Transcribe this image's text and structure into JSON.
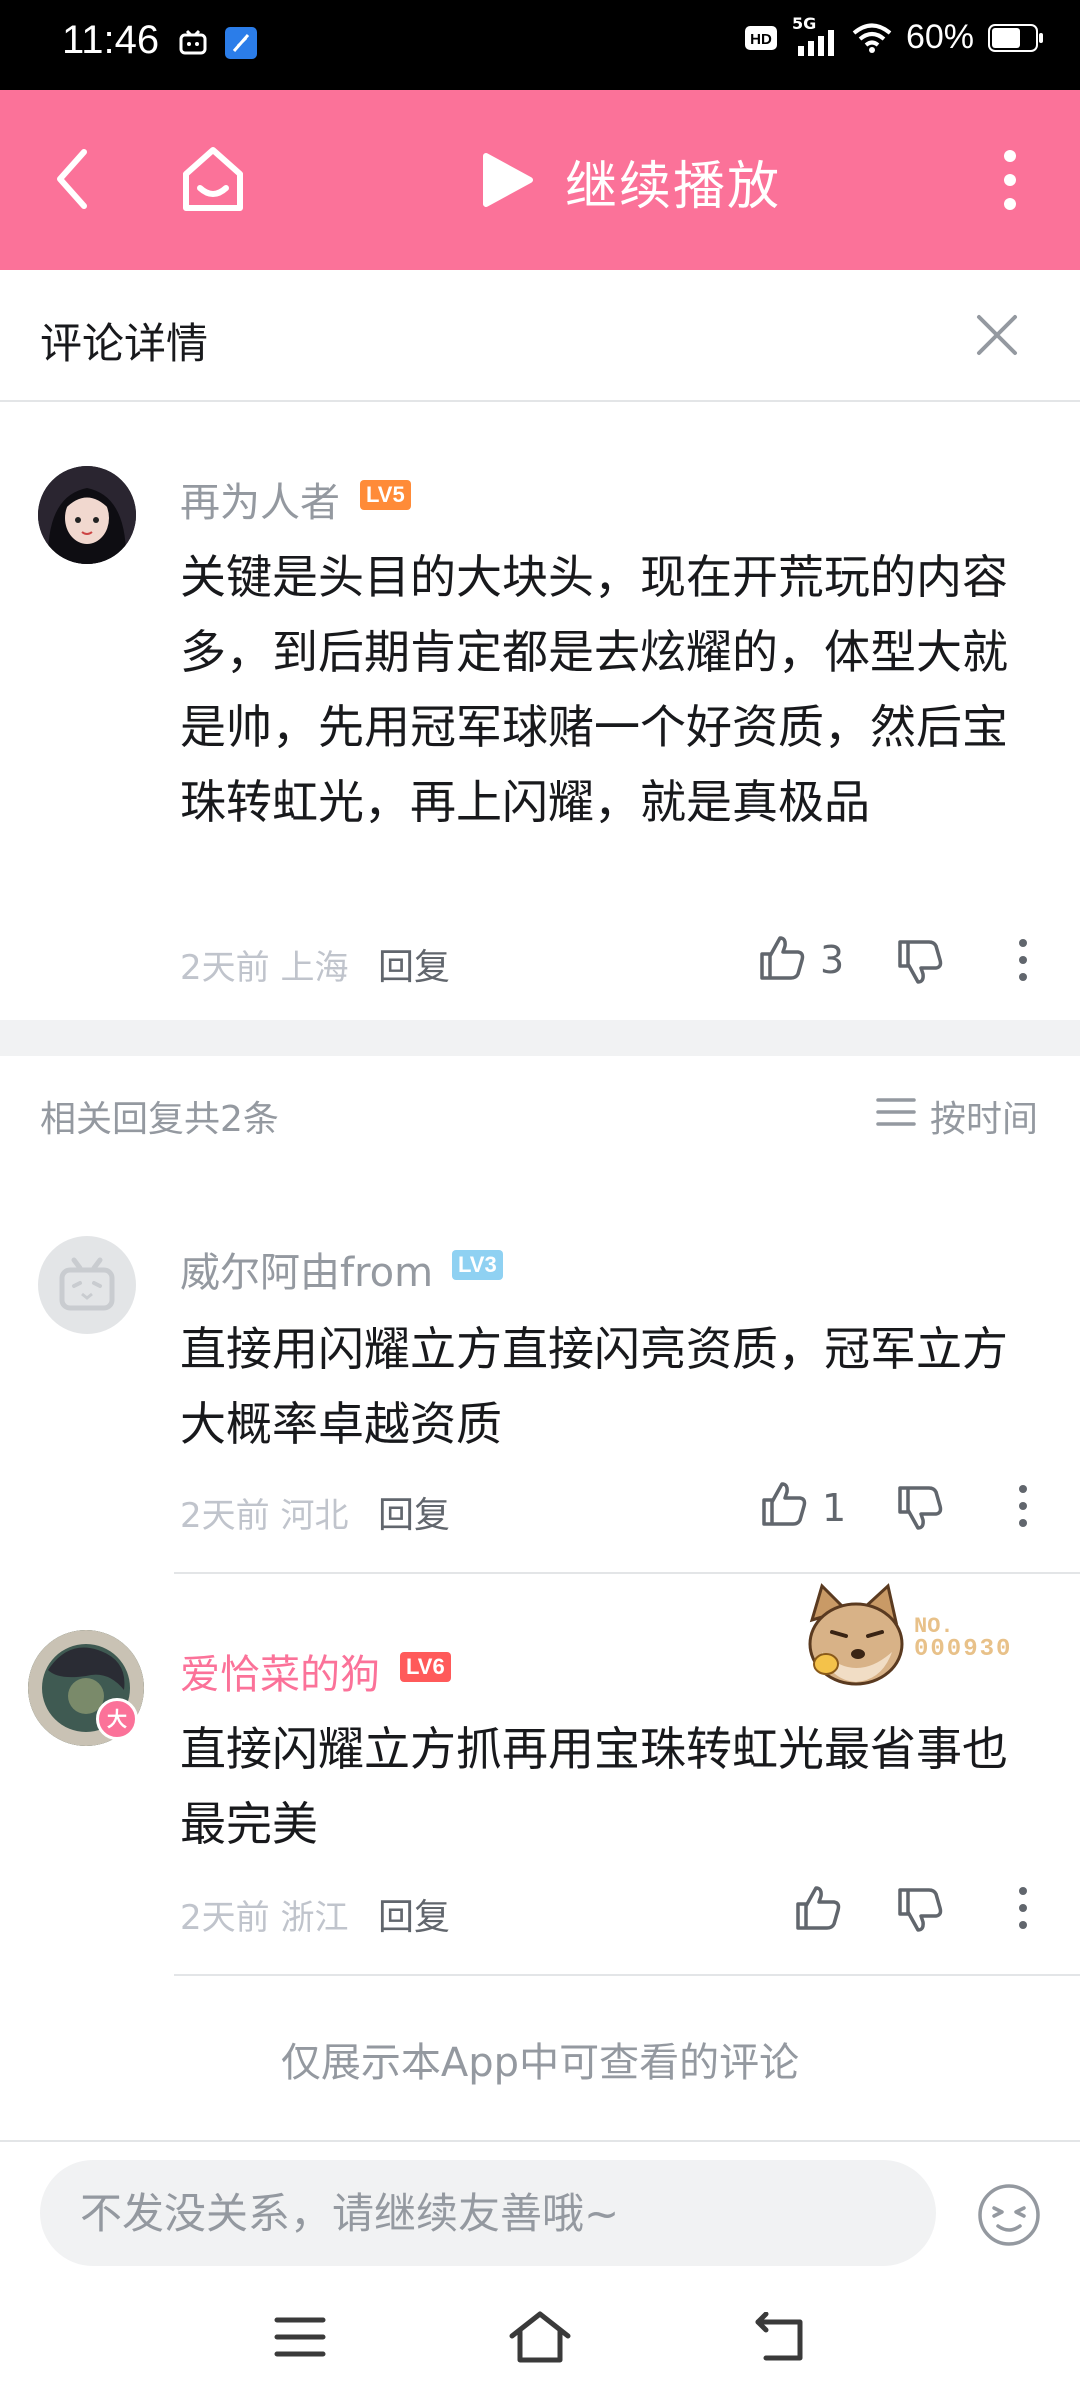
{
  "status": {
    "time": "11:46",
    "network": "5G",
    "battery": "60%"
  },
  "header": {
    "title": "继续播放"
  },
  "detail": {
    "title": "评论详情"
  },
  "main_comment": {
    "user": "再为人者",
    "level": "LV5",
    "text": "关键是头目的大块头，现在开荒玩的内容多，到后期肯定都是去炫耀的，体型大就是帅，先用冠军球赌一个好资质，然后宝珠转虹光，再上闪耀，就是真极品",
    "time": "2天前",
    "location": "上海",
    "reply_label": "回复",
    "likes": "3"
  },
  "replies_header": {
    "count_text": "相关回复共2条",
    "sort_label": "按时间"
  },
  "replies": [
    {
      "user": "威尔阿由from",
      "level": "LV3",
      "text": "直接用闪耀立方直接闪亮资质，冠军立方大概率卓越资质",
      "time": "2天前",
      "location": "河北",
      "reply_label": "回复",
      "likes": "1"
    },
    {
      "user": "爱恰菜的狗",
      "level": "LV6",
      "text": "直接闪耀立方抓再用宝珠转虹光最省事也最完美",
      "time": "2天前",
      "location": "浙江",
      "reply_label": "回复",
      "likes": "",
      "badge_no": "NO.",
      "badge_num": "000930",
      "avatar_badge": "大"
    }
  ],
  "footnote": "仅展示本App中可查看的评论",
  "input": {
    "placeholder": "不发没关系，请继续友善哦~"
  },
  "colors": {
    "brand": "#fb7299",
    "lv5": "#ff8b38",
    "lv3": "#8fd1f2",
    "lv6": "#ff5a5a",
    "vip_name": "#fb7299"
  }
}
